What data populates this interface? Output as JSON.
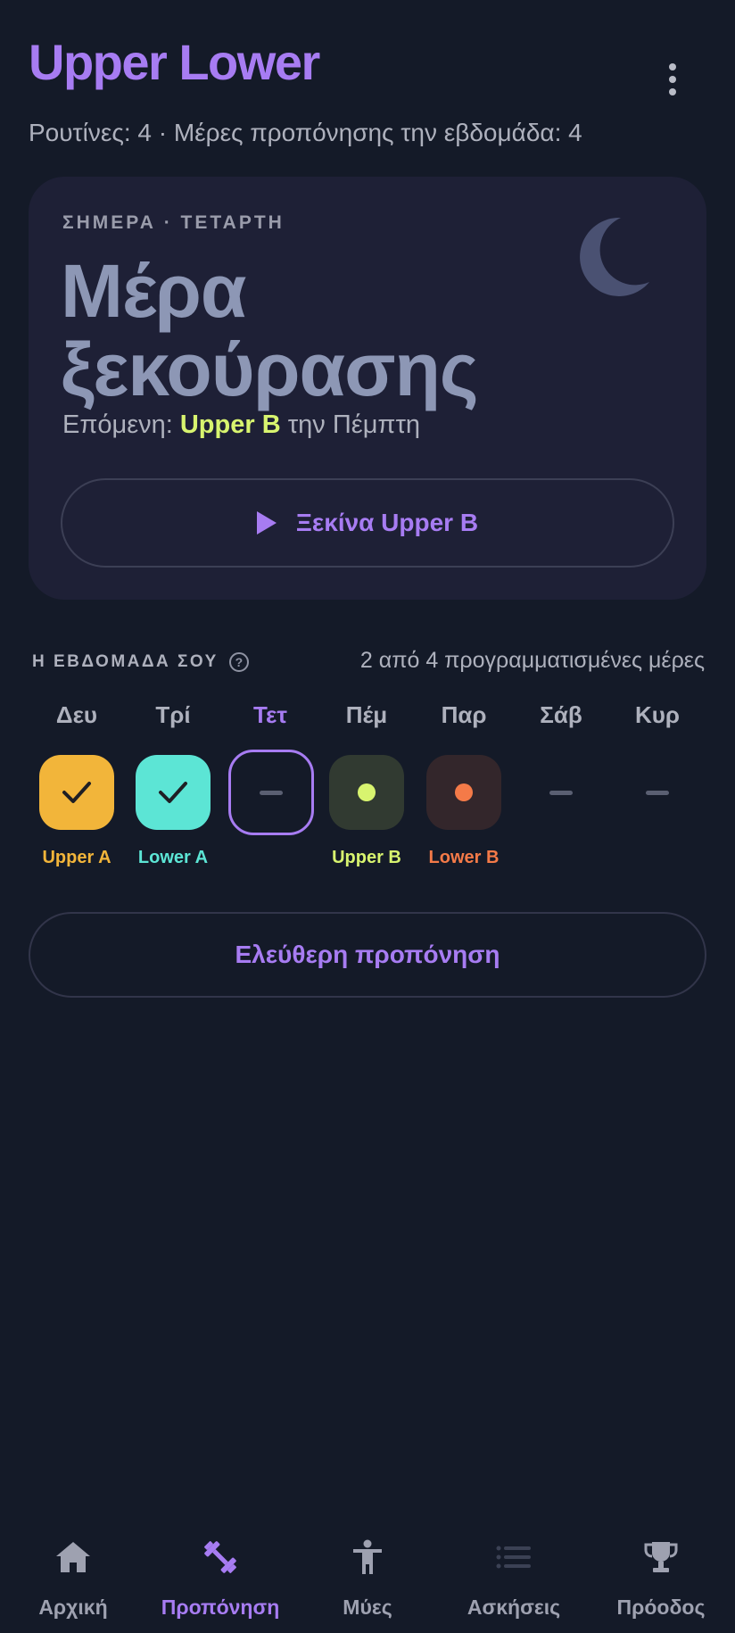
{
  "header": {
    "title": "Upper Lower",
    "subtitle": "Ρουτίνες: 4 · Μέρες προπόνησης την εβδομάδα: 4"
  },
  "today": {
    "label": "ΣΗΜΕΡΑ · ΤΕΤΑΡΤΗ",
    "title": "Μέρα ξεκούρασης",
    "next_prefix": "Επόμενη: ",
    "next_routine": "Upper B",
    "next_suffix": " την Πέμπτη",
    "start_button": "Ξεκίνα Upper B",
    "icon": "moon-icon"
  },
  "week": {
    "label": "Η ΕΒΔΟΜΑΔΑ ΣΟΥ",
    "count_text": "2 από 4 προγραμματισμένες μέρες",
    "days": [
      {
        "name": "Δευ",
        "status": "done",
        "routine": "Upper A",
        "color": "#f2b53a"
      },
      {
        "name": "Τρί",
        "status": "done",
        "routine": "Lower A",
        "color": "#5ce5d5"
      },
      {
        "name": "Τετ",
        "status": "today",
        "routine": "",
        "color": "#a77cf2"
      },
      {
        "name": "Πέμ",
        "status": "planned",
        "routine": "Upper B",
        "color": "#d8f46f"
      },
      {
        "name": "Παρ",
        "status": "planned",
        "routine": "Lower B",
        "color": "#f47a48"
      },
      {
        "name": "Σάβ",
        "status": "rest",
        "routine": "",
        "color": "#5a5f72"
      },
      {
        "name": "Κυρ",
        "status": "rest",
        "routine": "",
        "color": "#5a5f72"
      }
    ]
  },
  "free_workout_button": "Ελεύθερη προπόνηση",
  "nav": {
    "items": [
      {
        "label": "Αρχική",
        "icon": "home-icon",
        "active": false
      },
      {
        "label": "Προπόνηση",
        "icon": "dumbbell-icon",
        "active": true
      },
      {
        "label": "Μύες",
        "icon": "body-icon",
        "active": false
      },
      {
        "label": "Ασκήσεις",
        "icon": "list-icon",
        "active": false
      },
      {
        "label": "Πρόοδος",
        "icon": "trophy-icon",
        "active": false
      }
    ]
  },
  "colors": {
    "background": "#141a28",
    "accent": "#a77cf2",
    "card": "#1e2036",
    "highlight": "#d8f46f"
  }
}
